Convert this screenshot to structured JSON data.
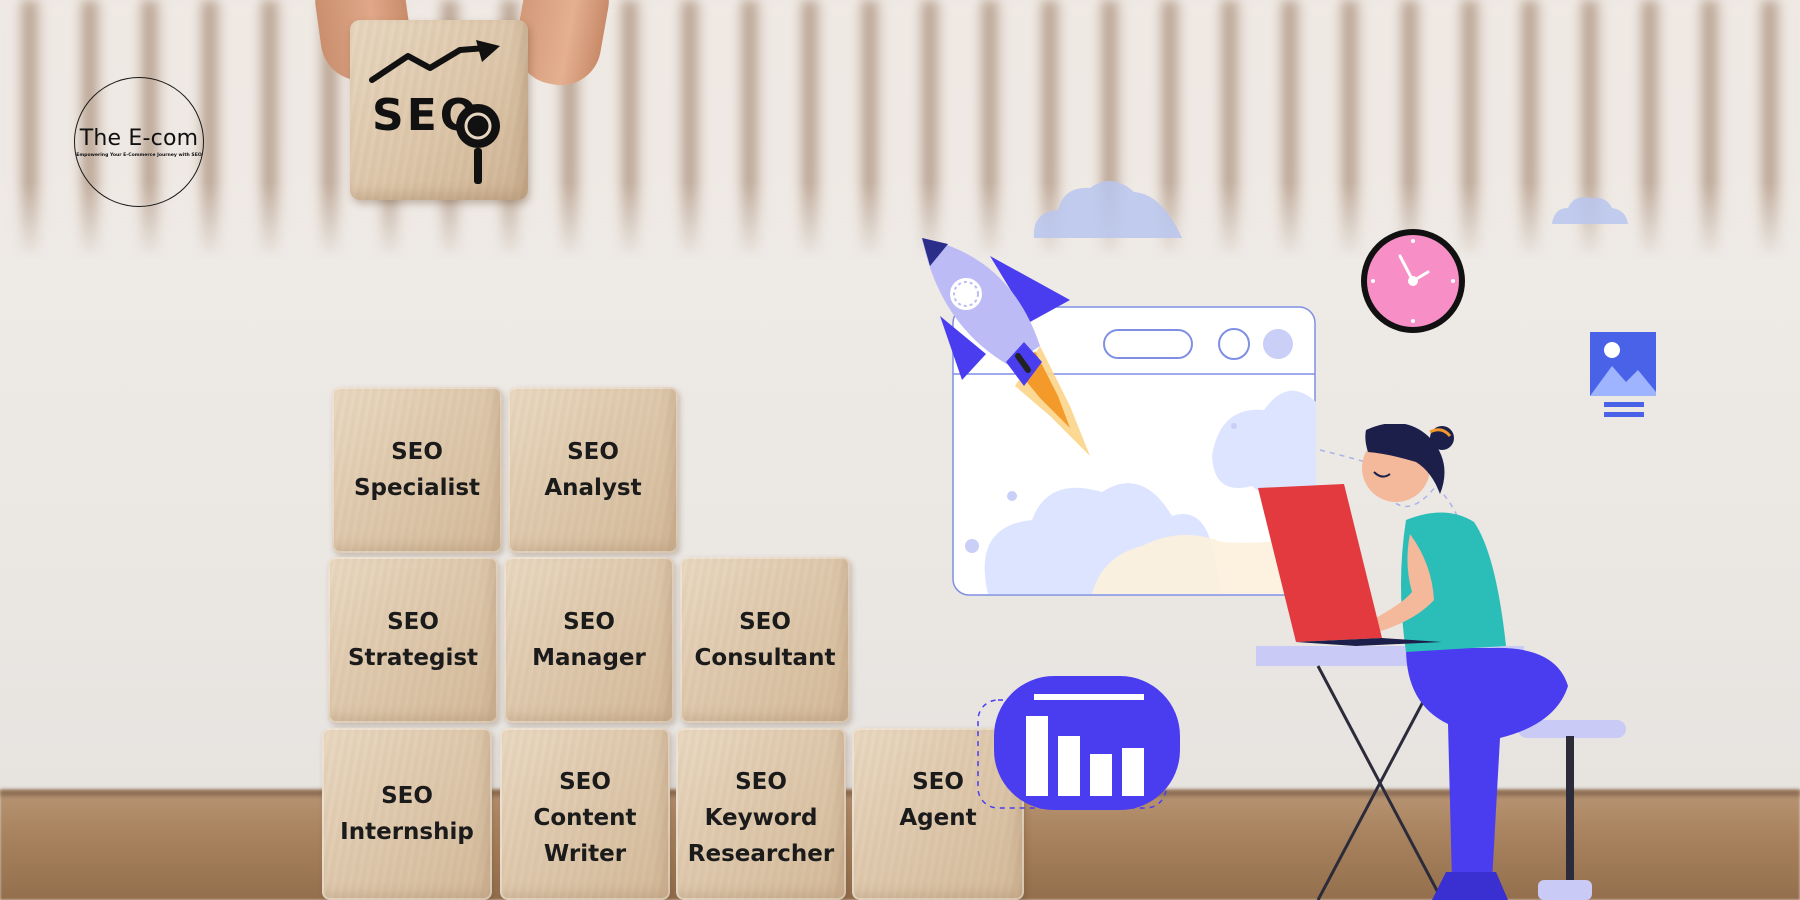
{
  "logo": {
    "title": "The E-com",
    "tagline": "Empowering Your E-Commerce Journey with SEO"
  },
  "cube": {
    "text": "SEO"
  },
  "blocks": [
    {
      "line1": "SEO",
      "line2": "Specialist"
    },
    {
      "line1": "SEO",
      "line2": "Analyst"
    },
    {
      "line1": "SEO",
      "line2": "Strategist"
    },
    {
      "line1": "SEO",
      "line2": "Manager"
    },
    {
      "line1": "SEO",
      "line2": "Consultant"
    },
    {
      "line1": "SEO",
      "line2": "Internship"
    },
    {
      "line1": "SEO",
      "line2": "Content",
      "line3": "Writer"
    },
    {
      "line1": "SEO",
      "line2": "Keyword",
      "line3": "Researcher"
    },
    {
      "line1": "SEO",
      "line2": "Agent"
    }
  ],
  "colors": {
    "accent_blue": "#4a3df0",
    "rocket_lavender": "#b9b7f5",
    "clock_pink": "#f78fc6",
    "laptop_red": "#e23a3e",
    "shirt_teal": "#2bbeb8"
  },
  "icons": [
    "seo-trend-icon",
    "magnifier-icon",
    "rocket-icon",
    "browser-window-icon",
    "clock-icon",
    "image-icon",
    "bar-chart-icon",
    "cloud-icon"
  ]
}
